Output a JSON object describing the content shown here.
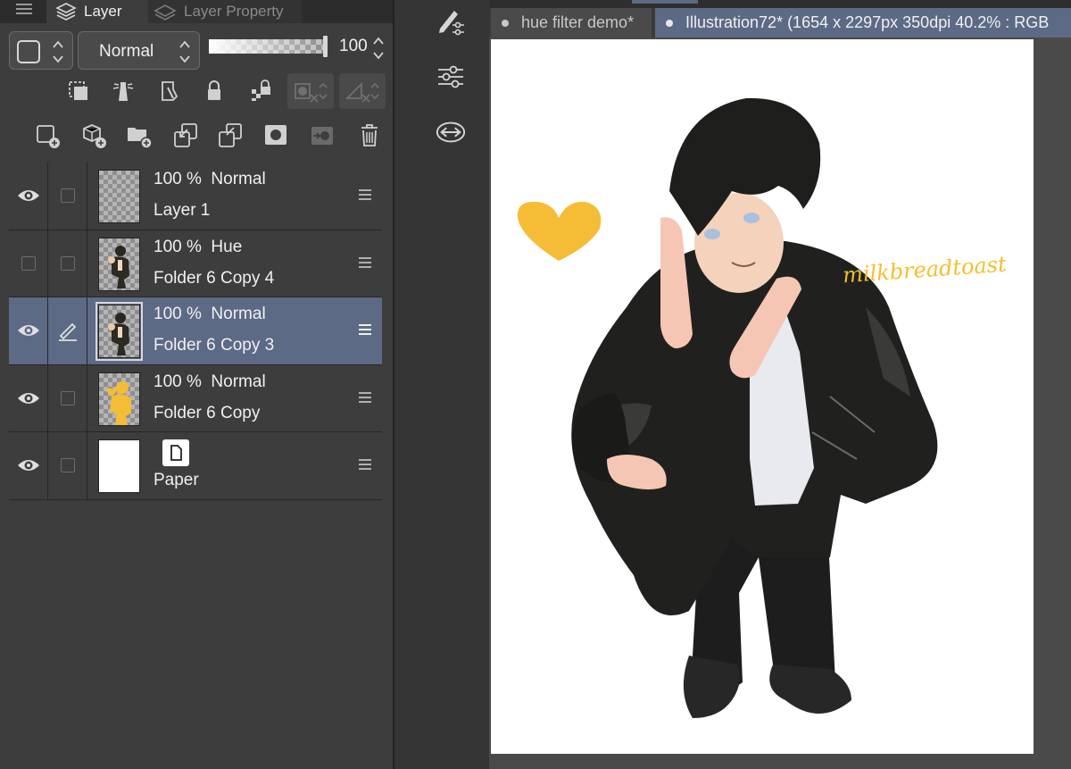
{
  "layer_panel": {
    "tabs": [
      {
        "label": "Layer",
        "icon": "layers-icon",
        "active": true
      },
      {
        "label": "Layer Property",
        "icon": "layer-property-icon",
        "active": false
      }
    ],
    "blend_mode": "Normal",
    "opacity": "100",
    "layers": [
      {
        "line1": "100 %  Normal",
        "name": "Layer 1",
        "visible": true,
        "thumb": "transparent",
        "selected": false
      },
      {
        "line1": "100 %  Hue",
        "name": "Folder 6 Copy 4",
        "visible": false,
        "thumb": "figure",
        "selected": false
      },
      {
        "line1": "100 %  Normal",
        "name": "Folder 6 Copy 3",
        "visible": true,
        "thumb": "figure",
        "selected": true,
        "editing": true
      },
      {
        "line1": "100 %  Normal",
        "name": "Folder 6 Copy",
        "visible": true,
        "thumb": "yellow-figure",
        "selected": false
      },
      {
        "line1": "",
        "name": "Paper",
        "visible": true,
        "thumb": "paper",
        "selected": false
      }
    ]
  },
  "canvas_area": {
    "tabs": [
      {
        "label": "hue filter demo*",
        "active": false
      },
      {
        "label": "Illustration72* (1654 x 2297px 350dpi 40.2% : RGB",
        "active": true
      }
    ],
    "watermark": "milkbreadtoast",
    "heart_color": "#f5bd35"
  },
  "colors": {
    "panel_bg": "#3d3d3d",
    "selected_row": "#5d6a85",
    "accent_yellow": "#f5bd35"
  }
}
